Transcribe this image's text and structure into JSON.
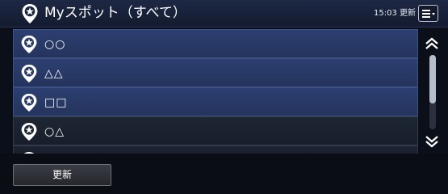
{
  "header": {
    "title": "Myスポット（すべて）",
    "time_status": "15:03 更新",
    "menu_icon": "hamburger-dropdown-icon",
    "title_icon": "pin-star-icon"
  },
  "list": {
    "items": [
      {
        "label": "○○",
        "icon": "pin-star-icon"
      },
      {
        "label": "△△",
        "icon": "pin-star-icon"
      },
      {
        "label": "□□",
        "icon": "pin-star-icon"
      },
      {
        "label": "○△",
        "icon": "pin-star-icon"
      },
      {
        "label": "",
        "icon": "pin-star-icon"
      }
    ]
  },
  "scrollbar": {
    "up_icon": "double-chevron-up-icon",
    "down_icon": "double-chevron-down-icon"
  },
  "footer": {
    "refresh_label": "更新"
  },
  "colors": {
    "row_accent": "#2c3f70",
    "background": "#0b0f1a"
  }
}
